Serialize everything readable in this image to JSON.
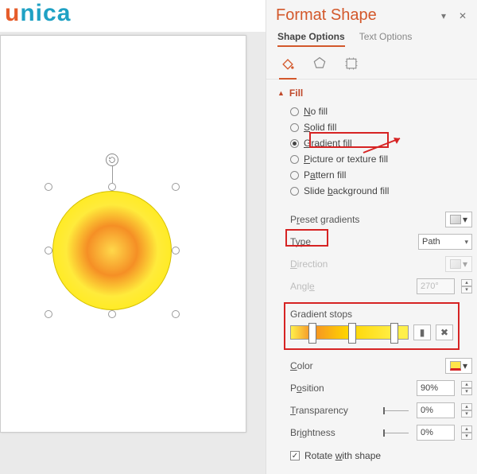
{
  "logo": {
    "u": "u",
    "n": "n",
    "i": "i",
    "c": "c",
    "a": "a"
  },
  "panel": {
    "title": "Format Shape",
    "tabs": {
      "shape": "Shape Options",
      "text": "Text Options"
    },
    "section_fill": "Fill",
    "fill_options": {
      "no_fill": "No fill",
      "solid": "Solid fill",
      "gradient": "Gradient fill",
      "picture": "Picture or texture fill",
      "pattern": "Pattern fill",
      "slidebg": "Slide background fill"
    },
    "labels": {
      "preset": "Preset gradients",
      "type": "Type",
      "type_value": "Path",
      "direction": "Direction",
      "angle": "Angle",
      "angle_value": "270°",
      "stops": "Gradient stops",
      "color": "Color",
      "position": "Position",
      "position_value": "90%",
      "transparency": "Transparency",
      "transparency_value": "0%",
      "brightness": "Brightness",
      "brightness_value": "0%",
      "rotate": "Rotate with shape"
    }
  }
}
